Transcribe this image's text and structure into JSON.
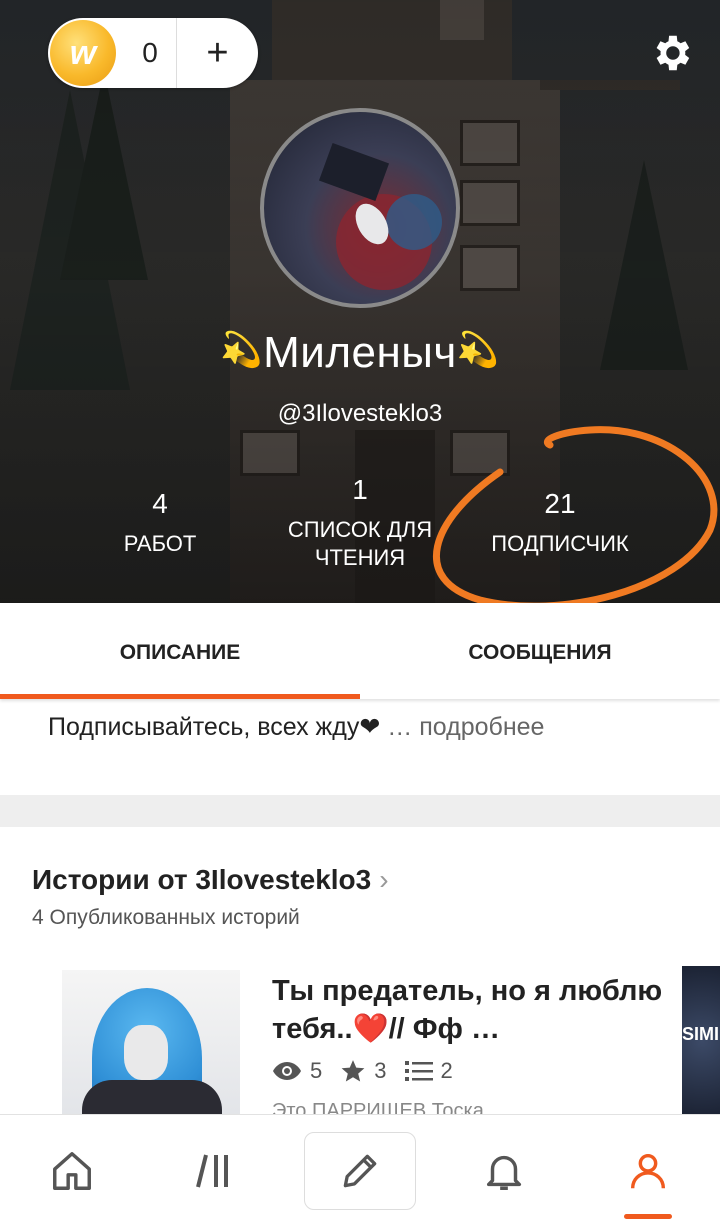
{
  "wallet": {
    "coins": "0",
    "add_label": "+",
    "coin_letter": "w"
  },
  "profile": {
    "display_name": "Миленыч",
    "name_decoration": "💫",
    "handle": "@3Ilovesteklo3"
  },
  "stats": [
    {
      "value": "4",
      "label": "РАБОТ"
    },
    {
      "value": "1",
      "label": "СПИСОК ДЛЯ ЧТЕНИЯ"
    },
    {
      "value": "21",
      "label": "ПОДПИСЧИК"
    }
  ],
  "tabs": [
    {
      "label": "ОПИСАНИЕ",
      "active": true
    },
    {
      "label": "СООБЩЕНИЯ",
      "active": false
    }
  ],
  "description": {
    "text": "Подписывайтесь, всех жду❤",
    "more": "… подробнее"
  },
  "stories": {
    "title": "Истории от 3Ilovesteklo3",
    "subtitle": "4 Опубликованных историй",
    "items": [
      {
        "title": "Ты предатель, но я люблю тебя..❤️// Фф …",
        "views": "5",
        "votes": "3",
        "parts": "2",
        "desc": "Это ПАРРИЩЕВ Тоска..."
      }
    ],
    "next_cover_text": "SIMI"
  },
  "bottom_nav": [
    {
      "icon": "home-icon"
    },
    {
      "icon": "library-icon"
    },
    {
      "icon": "pencil-icon"
    },
    {
      "icon": "bell-icon"
    },
    {
      "icon": "profile-icon",
      "active": true
    }
  ],
  "colors": {
    "accent": "#f05a1e",
    "coin": "#f9b92b"
  }
}
